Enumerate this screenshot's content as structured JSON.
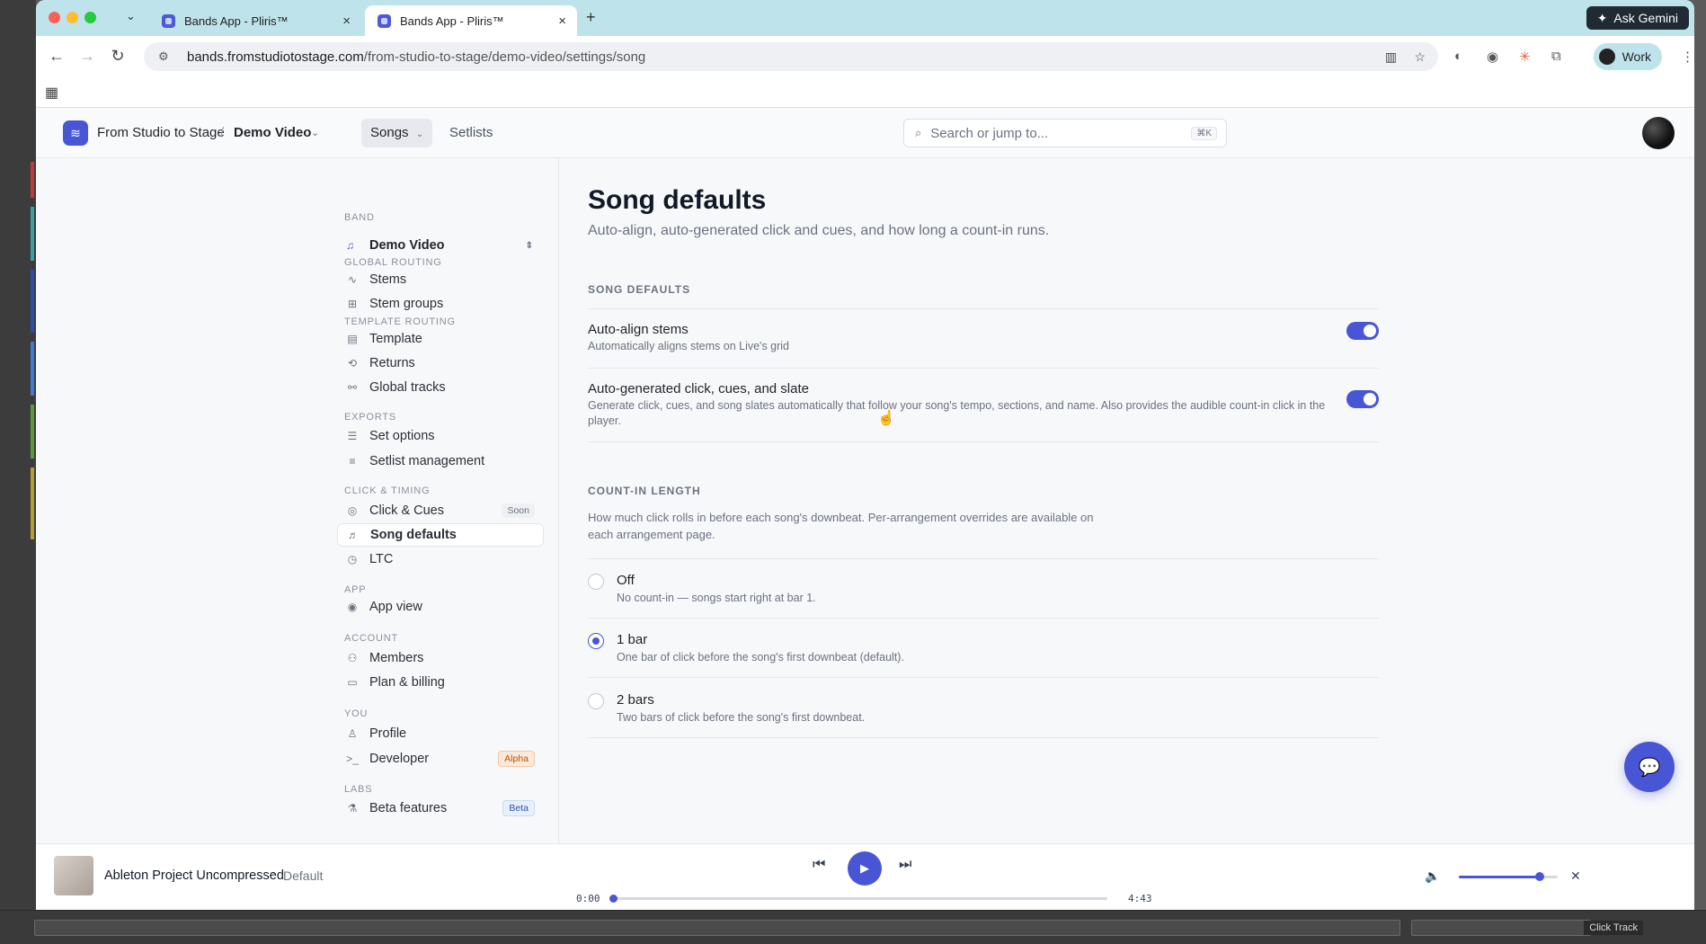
{
  "browser": {
    "tabs": [
      {
        "title": "Bands App - Pliris™",
        "active": false
      },
      {
        "title": "Bands App - Pliris™",
        "active": true
      }
    ],
    "new_tab": "+",
    "ask_gemini": "Ask Gemini",
    "url_host": "bands.fromstudiotostage.com",
    "url_path": "/from-studio-to-stage/demo-video/settings/song",
    "profile": "Work"
  },
  "app": {
    "org": "From Studio to Stage",
    "separator": "/",
    "project": "Demo Video",
    "nav": {
      "songs": "Songs",
      "setlists": "Setlists"
    },
    "search_placeholder": "Search or jump to...",
    "search_shortcut": "⌘K"
  },
  "sidebar": {
    "band_label": "BAND",
    "band_value": "Demo Video",
    "sections": [
      {
        "title": "GLOBAL ROUTING",
        "items": [
          "Stems",
          "Stem groups"
        ]
      },
      {
        "title": "TEMPLATE ROUTING",
        "items": [
          "Template",
          "Returns",
          "Global tracks"
        ]
      },
      {
        "title": "EXPORTS",
        "items": [
          "Set options",
          "Setlist management"
        ]
      },
      {
        "title": "CLICK & TIMING",
        "items": [
          "Click & Cues",
          "Song defaults",
          "LTC"
        ]
      },
      {
        "title": "APP",
        "items": [
          "App view"
        ]
      },
      {
        "title": "ACCOUNT",
        "items": [
          "Members",
          "Plan & billing"
        ]
      },
      {
        "title": "YOU",
        "items": [
          "Profile",
          "Developer"
        ]
      },
      {
        "title": "LABS",
        "items": [
          "Beta features"
        ]
      }
    ],
    "badges": {
      "soon": "Soon",
      "alpha": "Alpha",
      "beta": "Beta"
    },
    "active_item": "Song defaults"
  },
  "content": {
    "title": "Song defaults",
    "subtitle": "Auto-align, auto-generated click and cues, and how long a count-in runs.",
    "section1": "SONG DEFAULTS",
    "rows": [
      {
        "title": "Auto-align stems",
        "desc": "Automatically aligns stems on Live's grid",
        "enabled": true
      },
      {
        "title": "Auto-generated click, cues, and slate",
        "desc": "Generate click, cues, and song slates automatically that follow your song's tempo, sections, and name. Also provides the audible count-in click in the player.",
        "enabled": true
      }
    ],
    "section2": "COUNT-IN LENGTH",
    "section2_desc": "How much click rolls in before each song's downbeat. Per-arrangement overrides are available on each arrangement page.",
    "options": [
      {
        "label": "Off",
        "desc": "No count-in — songs start right at bar 1.",
        "selected": false
      },
      {
        "label": "1 bar",
        "desc": "One bar of click before the song's first downbeat (default).",
        "selected": true
      },
      {
        "label": "2 bars",
        "desc": "Two bars of click before the song's first downbeat.",
        "selected": false
      }
    ]
  },
  "player": {
    "track": "Ableton Project Uncompressed",
    "dot": "•",
    "variant": "Default",
    "elapsed": "0:00",
    "duration": "4:43",
    "progress": 0.0,
    "volume": 0.82
  },
  "desktop": {
    "click_track": "Click Track"
  },
  "colors": {
    "accent": "#4856d6",
    "tabstrip": "#bfe3ea"
  }
}
